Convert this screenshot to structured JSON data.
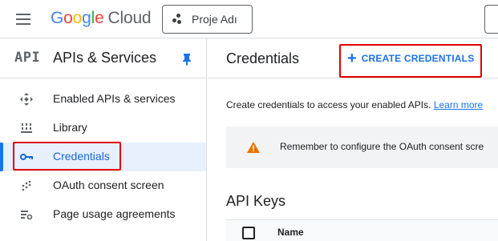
{
  "header": {
    "logo_google": [
      "G",
      "o",
      "o",
      "g",
      "l",
      "e"
    ],
    "logo_cloud": "Cloud",
    "project_label": "Proje Adı"
  },
  "sidebar": {
    "badge": "API",
    "title": "APIs & Services",
    "items": [
      {
        "label": "Enabled APIs & services",
        "icon": "diamond-arrows-icon",
        "active": false
      },
      {
        "label": "Library",
        "icon": "library-icon",
        "active": false
      },
      {
        "label": "Credentials",
        "icon": "key-icon",
        "active": true
      },
      {
        "label": "OAuth consent screen",
        "icon": "consent-dots-icon",
        "active": false
      },
      {
        "label": "Page usage agreements",
        "icon": "agreements-gear-icon",
        "active": false
      }
    ]
  },
  "main": {
    "title": "Credentials",
    "create_label": "CREATE CREDENTIALS",
    "description": "Create credentials to access your enabled APIs. ",
    "learn_more": "Learn more",
    "banner_text": "Remember to configure the OAuth consent scre",
    "section_title": "API Keys",
    "table_columns": [
      "Name"
    ]
  },
  "colors": {
    "accent": "#1a73e8",
    "active_bg": "#e8f0fe",
    "highlight": "#e00000",
    "warning": "#e37400"
  }
}
